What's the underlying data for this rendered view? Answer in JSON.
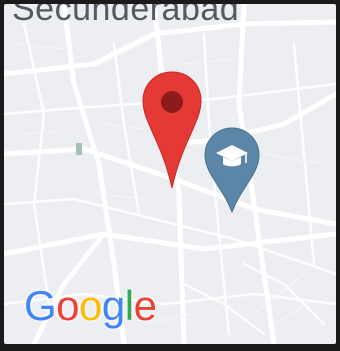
{
  "map": {
    "place_label": "Secunderabad",
    "attribution": "Google",
    "markers": [
      {
        "name": "selected-location",
        "icon": "map-pin-icon",
        "color": "#e53935"
      },
      {
        "name": "school",
        "icon": "graduation-cap-icon",
        "color": "#5b86a7"
      }
    ]
  },
  "logo_colors": [
    "#4285F4",
    "#EA4335",
    "#FBBC05",
    "#4285F4",
    "#34A853",
    "#EA4335"
  ]
}
